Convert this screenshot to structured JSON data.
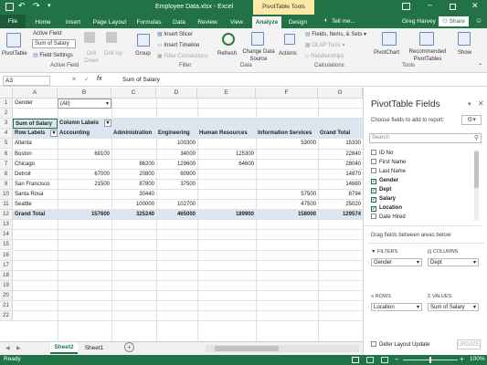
{
  "title": {
    "file": "Employee Data.xlsx - Excel",
    "context_tab": "PivotTable Tools",
    "user": "Greg Harvey"
  },
  "tabs": [
    "File",
    "Home",
    "Insert",
    "Page Layout",
    "Formulas",
    "Data",
    "Review",
    "View",
    "Analyze",
    "Design"
  ],
  "tell_me": "Tell me...",
  "share": "Share",
  "ribbon": {
    "pivottable": "PivotTable",
    "active_field_label": "Active Field:",
    "active_field_value": "Sum of Salary",
    "field_settings": "Field Settings",
    "drill_down": "Drill Down",
    "drill_up": "Drill Up",
    "group": "Group",
    "insert_slicer": "Insert Slicer",
    "insert_timeline": "Insert Timeline",
    "filter_connections": "Filter Connections",
    "refresh": "Refresh",
    "change_data_source": "Change Data Source",
    "actions": "Actions",
    "fields_items_sets": "Fields, Items, & Sets",
    "olap_tools": "OLAP Tools",
    "relationships": "Relationships",
    "pivotchart": "PivotChart",
    "recommended": "Recommended PivotTables",
    "show": "Show",
    "groups": [
      "Active Field",
      "Filter",
      "Data",
      "Calculations",
      "Tools"
    ]
  },
  "formula_bar": {
    "name_box": "A3",
    "fx": "fx",
    "content": "Sum of Salary"
  },
  "columns": [
    "A",
    "B",
    "C",
    "D",
    "E",
    "F",
    "G"
  ],
  "rows": [
    "1",
    "2",
    "3",
    "4",
    "5",
    "6",
    "7",
    "8",
    "9",
    "10",
    "11",
    "12",
    "13",
    "14",
    "15",
    "16",
    "17",
    "18",
    "19",
    "20",
    "21",
    "22"
  ],
  "pivot": {
    "filter_label": "Gender",
    "filter_value": "(All)",
    "sum_label": "Sum of Salary",
    "col_labels": "Column Labels",
    "row_labels": "Row Labels",
    "headers": [
      "Accounting",
      "Administration",
      "Engineering",
      "Human Resources",
      "Information Services",
      "Grand Total"
    ],
    "data": [
      {
        "city": "Atlanta",
        "vals": [
          "",
          "",
          "100300",
          "",
          "53000",
          "15330"
        ]
      },
      {
        "city": "Boston",
        "vals": [
          "69100",
          "",
          "34000",
          "125300",
          "",
          "22840"
        ]
      },
      {
        "city": "Chicago",
        "vals": [
          "",
          "86200",
          "129600",
          "64600",
          "",
          "28040"
        ]
      },
      {
        "city": "Detroit",
        "vals": [
          "67000",
          "20800",
          "60900",
          "",
          "",
          "14870"
        ]
      },
      {
        "city": "San Francisco",
        "vals": [
          "21500",
          "87800",
          "37500",
          "",
          "",
          "14680"
        ]
      },
      {
        "city": "Santa Rosa",
        "vals": [
          "",
          "30440",
          "",
          "",
          "57500",
          "8794"
        ]
      },
      {
        "city": "Seattle",
        "vals": [
          "",
          "100000",
          "102700",
          "",
          "47500",
          "25020"
        ]
      }
    ],
    "total": {
      "label": "Grand Total",
      "vals": [
        "157600",
        "325240",
        "465000",
        "189900",
        "158000",
        "129574"
      ]
    }
  },
  "sheets": [
    "Sheet2",
    "Sheet1"
  ],
  "status": {
    "left": "Ready",
    "zoom": "100%"
  },
  "pane": {
    "title": "PivotTable Fields",
    "choose": "Choose fields to add to report:",
    "search_placeholder": "Search",
    "fields": [
      {
        "name": "ID No",
        "checked": false
      },
      {
        "name": "First Name",
        "checked": false
      },
      {
        "name": "Last Name",
        "checked": false
      },
      {
        "name": "Gender",
        "checked": true
      },
      {
        "name": "Dept",
        "checked": true
      },
      {
        "name": "Salary",
        "checked": true
      },
      {
        "name": "Location",
        "checked": true
      },
      {
        "name": "Date Hired",
        "checked": false
      }
    ],
    "drag_label": "Drag fields between areas below:",
    "filters_label": "FILTERS",
    "columns_label": "COLUMNS",
    "rows_label": "ROWS",
    "values_label": "VALUES",
    "filters_value": "Gender",
    "columns_value": "Dept",
    "rows_value": "Location",
    "values_value": "Sum of Salary",
    "defer": "Defer Layout Update",
    "update": "UPDATE"
  },
  "colors": {
    "excel_green": "#217346",
    "context_tab": "#fbe8a6",
    "pivot_header": "#dce6f1"
  }
}
